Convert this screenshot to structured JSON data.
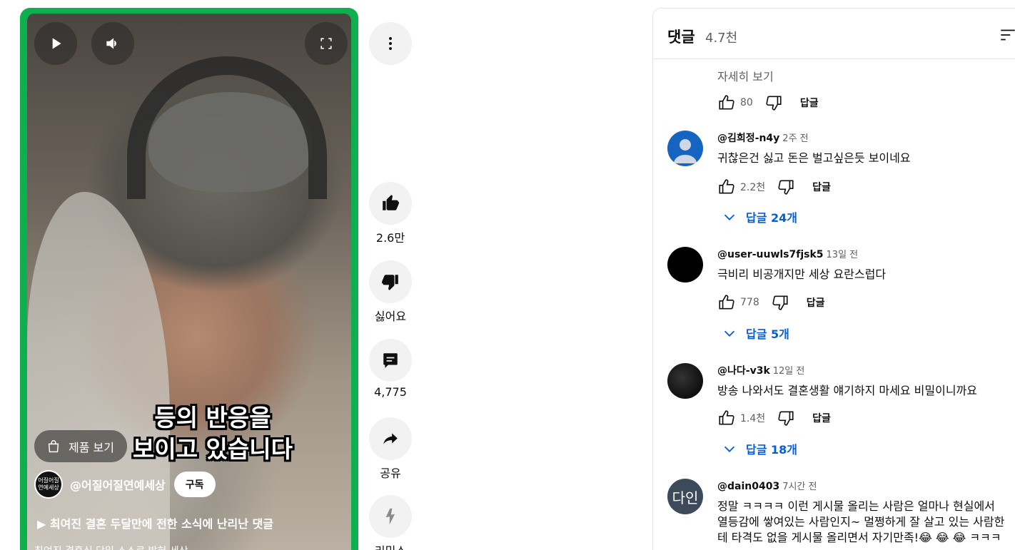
{
  "player": {
    "overlay_caption_line1": "등의 반응을",
    "overlay_caption_line2": "보이고 있습니다",
    "product_button": "제품 보기",
    "channel_handle": "@어질어질연예세상",
    "channel_avatar_text": "어질어질 연예세상",
    "subscribe_label": "구독",
    "video_title": "▶ 최여진 결혼 두달만에 전한 소식에 난리난 댓글",
    "video_desc": "최여진 결혼식 당일 스스로 밝혀 세상"
  },
  "actions": {
    "like_count": "2.6만",
    "dislike_label": "싫어요",
    "comment_count": "4,775",
    "share_label": "공유",
    "remix_label": "리믹스"
  },
  "comments_panel": {
    "title": "댓글",
    "count": "4.7천",
    "more_label": "자세히 보기",
    "top_item": {
      "likes": "80",
      "reply_label": "답글"
    },
    "items": [
      {
        "author": "@김희정-n4y",
        "time": "2주 전",
        "text": "귀찮은건 싫고 돈은 벌고싶은듯 보이네요",
        "likes": "2.2천",
        "reply_label": "답글",
        "replies_label": "답글 24개"
      },
      {
        "author": "@user-uuwls7fjsk5",
        "time": "13일 전",
        "text": "극비리 비공개지만 세상 요란스럽다",
        "likes": "778",
        "reply_label": "답글",
        "replies_label": "답글 5개"
      },
      {
        "author": "@나다-v3k",
        "time": "12일 전",
        "text": "방송 나와서도 결혼생활 얘기하지 마세요 비밀이니까요",
        "likes": "1.4천",
        "reply_label": "답글",
        "replies_label": "답글 18개"
      },
      {
        "author": "@dain0403",
        "time": "7시간 전",
        "avatar_text": "다인",
        "text_line1": "정말 ㅋㅋㅋㅋ 이런 게시물 올리는 사람은 얼마나 현실에서",
        "text_line2": "열등감에 쌓여있는 사람인지~ 멀쩡하게 잘 살고 있는 사람한",
        "text_line3": "테 타격도 없을 게시물 올리면서 자기만족!😂 😂 😂 ㅋㅋㅋ"
      }
    ]
  },
  "colors": {
    "player_border": "#0fae4e",
    "link_blue": "#065fd4",
    "avatar_blue": "#1565c0",
    "avatar_dain": "#3c4a5a"
  }
}
